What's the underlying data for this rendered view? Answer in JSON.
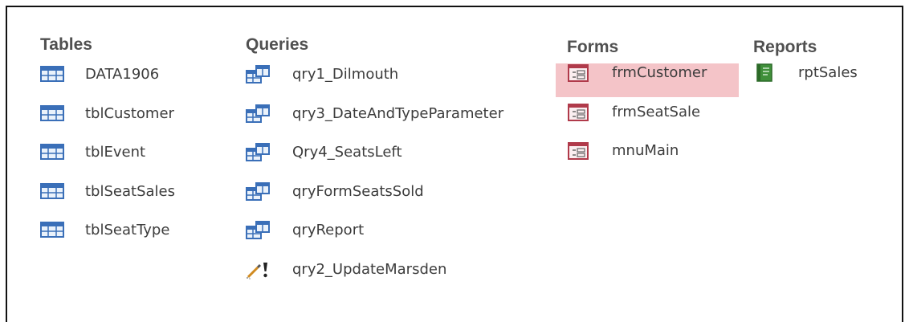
{
  "groups": {
    "tables": {
      "heading": "Tables",
      "items": [
        "DATA1906",
        "tblCustomer",
        "tblEvent",
        "tblSeatSales",
        "tblSeatType"
      ]
    },
    "queries": {
      "heading": "Queries",
      "items": [
        "qry1_Dilmouth",
        "qry3_DateAndTypeParameter",
        "Qry4_SeatsLeft",
        "qryFormSeatsSold",
        "qryReport",
        "qry2_UpdateMarsden"
      ]
    },
    "forms": {
      "heading": "Forms",
      "items": [
        "frmCustomer",
        "frmSeatSale",
        "mnuMain"
      ],
      "selected": "frmCustomer"
    },
    "reports": {
      "heading": "Reports",
      "items": [
        "rptSales"
      ]
    }
  },
  "icons": {
    "table": "table-icon",
    "select_query": "select-query-icon",
    "update_query": "update-query-icon",
    "form": "form-icon",
    "report": "report-icon"
  },
  "colors": {
    "selection": "#f4c4c8",
    "table_icon": "#3a6fb8",
    "form_icon": "#b03a4a",
    "report_icon": "#3f8f3a"
  }
}
